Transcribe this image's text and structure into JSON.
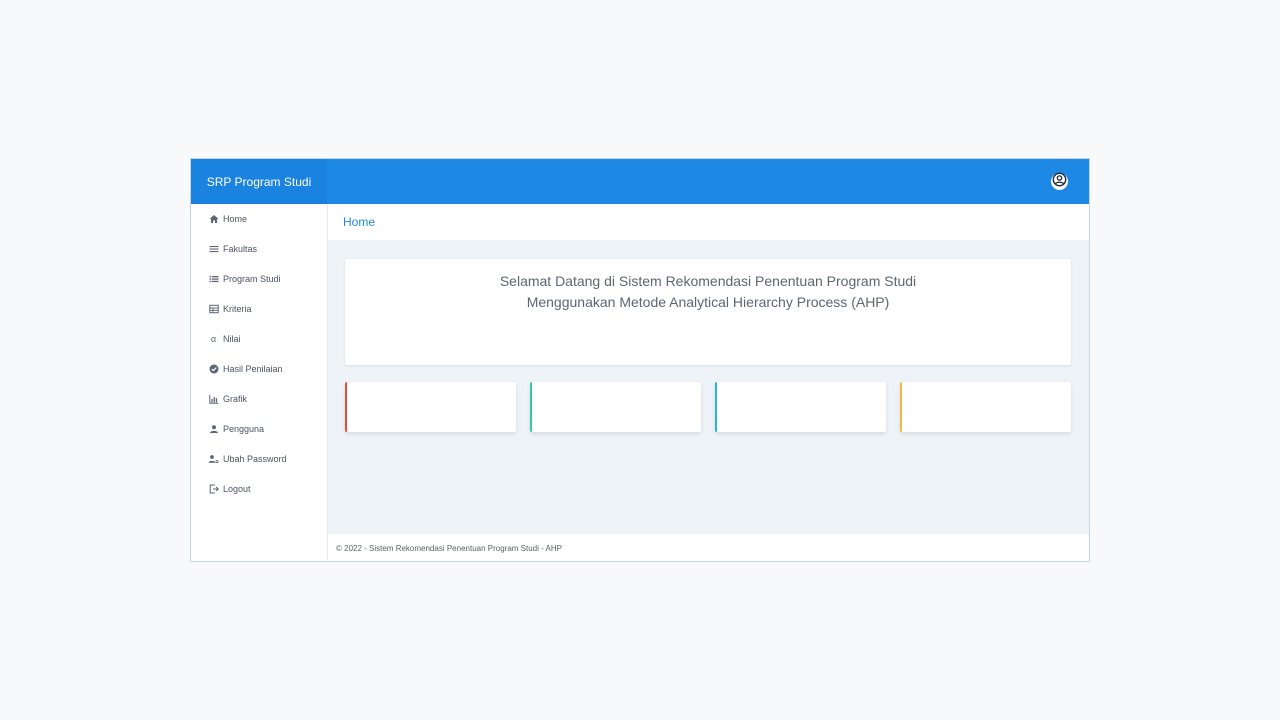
{
  "header": {
    "brand": "SRP Program Studi",
    "user_icon": "user-circle-icon"
  },
  "sidebar": {
    "items": [
      {
        "label": "Home",
        "icon": "home-icon"
      },
      {
        "label": "Fakultas",
        "icon": "list-icon"
      },
      {
        "label": "Program Studi",
        "icon": "list-alt-icon"
      },
      {
        "label": "Kriteria",
        "icon": "table-icon"
      },
      {
        "label": "Nilai",
        "icon": "alpha-icon"
      },
      {
        "label": "Hasil Penilaian",
        "icon": "check-circle-icon"
      },
      {
        "label": "Grafik",
        "icon": "bar-chart-icon"
      },
      {
        "label": "Pengguna",
        "icon": "user-icon"
      },
      {
        "label": "Ubah Password",
        "icon": "user-key-icon"
      },
      {
        "label": "Logout",
        "icon": "logout-icon"
      }
    ]
  },
  "breadcrumb": {
    "current": "Home"
  },
  "welcome": {
    "line1": "Selamat Datang di Sistem Rekomendasi Penentuan Program Studi",
    "line2": "Menggunakan Metode Analytical Hierarchy Process (AHP)"
  },
  "stat_cards": [
    {
      "accent": "#e74c3c"
    },
    {
      "accent": "#2ecc9a"
    },
    {
      "accent": "#2bb5d1"
    },
    {
      "accent": "#f4b63f"
    }
  ],
  "footer": {
    "text": "© 2022 - Sistem Rekomendasi Penentuan Program Studi - AHP"
  }
}
